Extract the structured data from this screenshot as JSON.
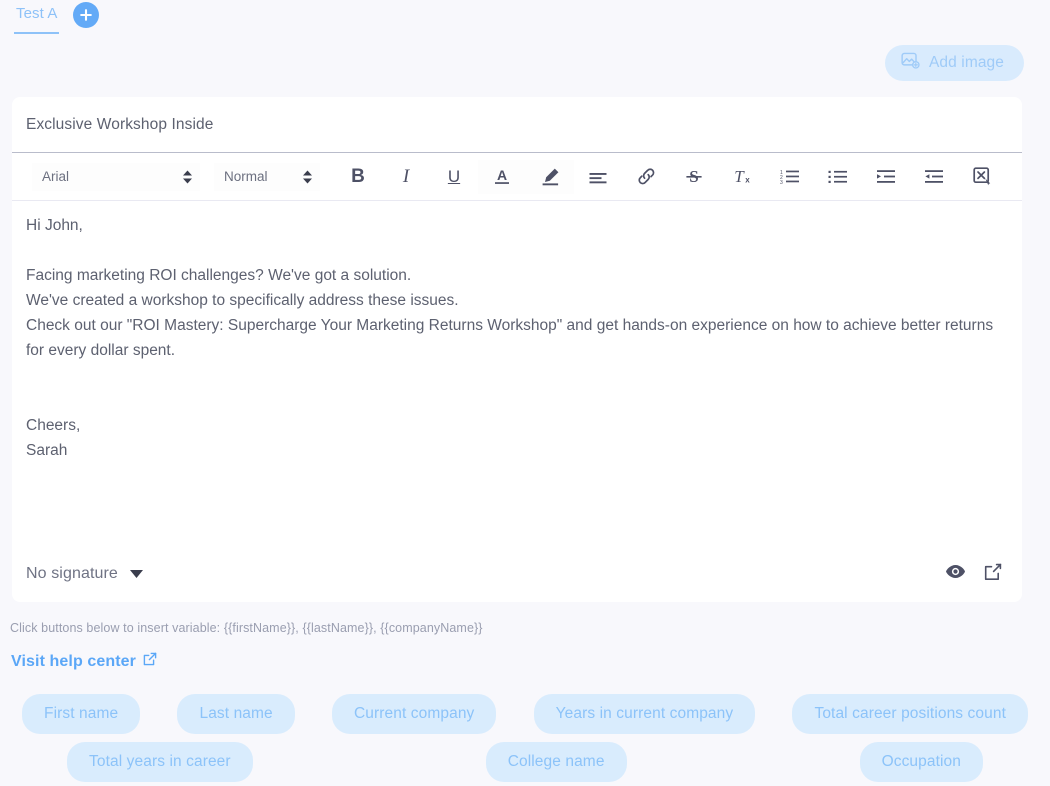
{
  "tabs": {
    "items": [
      {
        "label": "Test A",
        "active": true
      }
    ],
    "add_button_title": "Add variant"
  },
  "toolbar_top": {
    "add_image_label": "Add image",
    "add_image_icon": "image-plus-icon",
    "accent_color": "#5ba7f7",
    "chip_bg": "#d9ebfd"
  },
  "editor": {
    "subject": "Exclusive Workshop Inside",
    "subject_placeholder": "Subject",
    "font_family_value": "Arial",
    "font_size_value": "Normal",
    "format_buttons": [
      {
        "name": "bold",
        "label": "B"
      },
      {
        "name": "italic",
        "label": "I"
      },
      {
        "name": "underline",
        "label": "U"
      },
      {
        "name": "text-color",
        "label": "A"
      },
      {
        "name": "highlight",
        "label": ""
      },
      {
        "name": "align",
        "label": ""
      },
      {
        "name": "link",
        "label": ""
      },
      {
        "name": "strikethrough",
        "label": "S"
      },
      {
        "name": "clear-format",
        "label": "Tx"
      },
      {
        "name": "ordered-list",
        "label": ""
      },
      {
        "name": "bullet-list",
        "label": ""
      },
      {
        "name": "indent",
        "label": ""
      },
      {
        "name": "outdent",
        "label": ""
      },
      {
        "name": "remove-styles",
        "label": ""
      }
    ],
    "body": {
      "greeting": "Hi John,",
      "line1": "Facing marketing ROI challenges? We've got a solution.",
      "line2": "We've created a workshop to specifically address these issues.",
      "line3": "Check out our \"ROI Mastery: Supercharge Your Marketing Returns Workshop\" and get hands-on experience on how to achieve better returns for every dollar spent.",
      "signoff1": "Cheers,",
      "signoff2": "Sarah"
    },
    "signature_label": "No signature",
    "preview_icon": "eye-icon",
    "popout_icon": "external-link-icon"
  },
  "hint": {
    "text": "Click buttons below to insert variable: {{firstName}}, {{lastName}}, {{companyName}}"
  },
  "help": {
    "label": "Visit help center",
    "icon": "external-link-icon"
  },
  "variables": {
    "row1": [
      {
        "label": "First name"
      },
      {
        "label": "Last name"
      },
      {
        "label": "Current company"
      },
      {
        "label": "Years in current company"
      },
      {
        "label": "Total career positions count"
      }
    ],
    "row2": [
      {
        "label": "Total years in career"
      },
      {
        "label": "College name"
      },
      {
        "label": "Occupation"
      }
    ]
  }
}
